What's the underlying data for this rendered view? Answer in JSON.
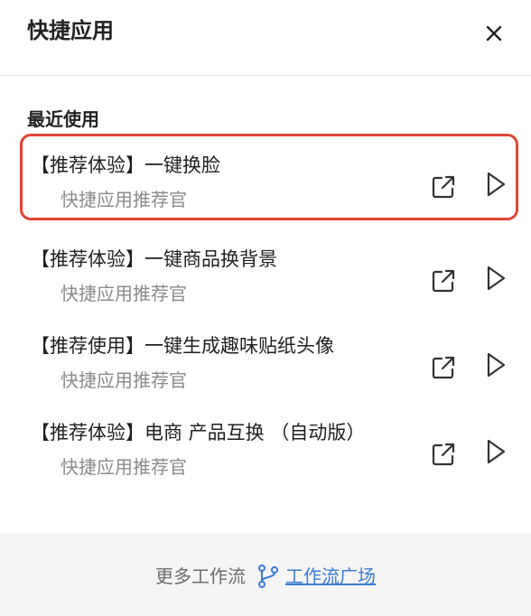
{
  "header": {
    "title": "快捷应用"
  },
  "section": {
    "recent_title": "最近使用"
  },
  "items": [
    {
      "title": "【推荐体验】一键换脸",
      "subtitle": "快捷应用推荐官"
    },
    {
      "title": "【推荐体验】一键商品换背景",
      "subtitle": "快捷应用推荐官"
    },
    {
      "title": "【推荐使用】一键生成趣味贴纸头像",
      "subtitle": "快捷应用推荐官"
    },
    {
      "title": "【推荐体验】电商 产品互换 （自动版）",
      "subtitle": "快捷应用推荐官"
    }
  ],
  "footer": {
    "text": "更多工作流",
    "link": "工作流广场"
  },
  "colors": {
    "highlight_border": "#e44332",
    "link": "#3a7bd5",
    "muted": "#8a8a8a",
    "footer_bg": "#f5f5f5"
  },
  "icons": {
    "close": "close-icon",
    "open": "external-link-icon",
    "run": "play-icon",
    "workflow": "git-branch-icon"
  }
}
